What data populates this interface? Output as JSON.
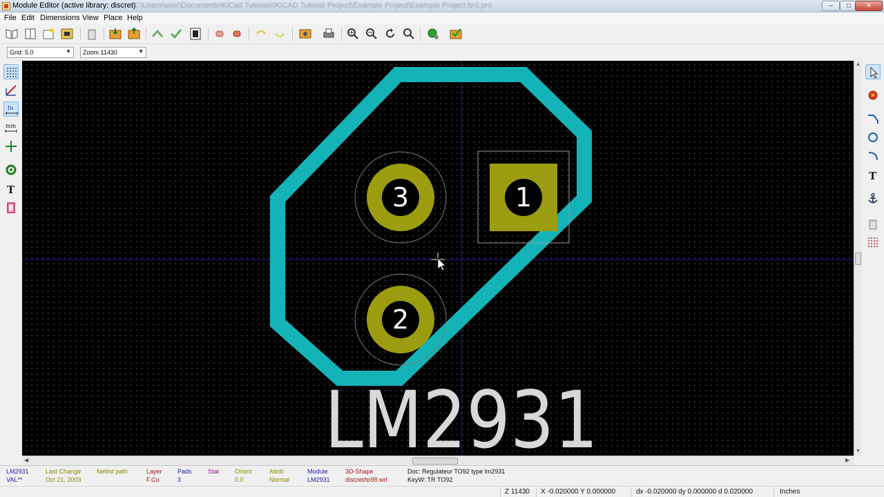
{
  "window": {
    "title": "Module Editor (active library: discret)",
    "path": "C:\\Users\\user\\Documents\\KiCad Tutorials\\KiCAD Tutorial Project\\Example Project\\Example Project.brd.pro",
    "minimize": "–",
    "maximize": "□",
    "close": "✕"
  },
  "menu": [
    "File",
    "Edit",
    "Dimensions",
    "View",
    "Place",
    "Help"
  ],
  "options": {
    "grid": "Grid: 5.0",
    "zoom": "Zoom 11430"
  },
  "colors": {
    "canvas_bg": "#000000",
    "outline": "#14b3b7",
    "pad": "#9c9c10",
    "courtyard": "#d8d8d8",
    "axis": "#1c1ca6",
    "reference_text": "#d8d8d8"
  },
  "footprint": {
    "reference": "LM2931",
    "pads": [
      {
        "number": "1",
        "shape": "rect"
      },
      {
        "number": "2",
        "shape": "circle"
      },
      {
        "number": "3",
        "shape": "circle"
      }
    ]
  },
  "left_tools": [
    {
      "icon": "grid-icon",
      "active": true
    },
    {
      "icon": "polar-coords-icon",
      "active": false
    },
    {
      "icon": "inch-units-icon",
      "label": "In",
      "active": true
    },
    {
      "icon": "mm-units-icon",
      "label": "mm",
      "active": false
    },
    {
      "icon": "cursor-shape-icon",
      "active": false
    },
    {
      "icon": "show-pads-sketch-icon",
      "active": false
    },
    {
      "icon": "text-sketch-icon",
      "label": "T",
      "active": false
    },
    {
      "icon": "edges-sketch-icon",
      "active": false
    }
  ],
  "right_tools": [
    {
      "icon": "select-arrow-icon",
      "active": true
    },
    {
      "icon": "add-pad-icon"
    },
    {
      "icon": "add-line-icon"
    },
    {
      "icon": "add-circle-icon"
    },
    {
      "icon": "add-arc-icon"
    },
    {
      "icon": "add-text-icon",
      "label": "T"
    },
    {
      "icon": "anchor-icon"
    },
    {
      "icon": "delete-icon"
    },
    {
      "icon": "pad-grid-icon"
    }
  ],
  "message_panel": {
    "columns": [
      {
        "header": "LM2931",
        "value": "VAL**",
        "color": "#1a1aa8"
      },
      {
        "header": "Last Change",
        "value": "Oct 21, 2003",
        "color": "#8a8a00"
      },
      {
        "header": "Netlist path",
        "value": "",
        "color": "#8a8a00"
      },
      {
        "header": "Layer",
        "value": "F.Cu",
        "color": "#9a1414"
      },
      {
        "header": "Pads",
        "value": "3",
        "color": "#1a1aa8"
      },
      {
        "header": "Stat",
        "value": "",
        "color": "#8a1a8a"
      },
      {
        "header": "Orient",
        "value": "0.0",
        "color": "#8a8a00"
      },
      {
        "header": "Attrib",
        "value": "Normal",
        "color": "#8a8a00"
      },
      {
        "header": "Module",
        "value": "LM2931",
        "color": "#1a1aa8"
      },
      {
        "header": "3D-Shape",
        "value": "discret/to98.wrl",
        "color": "#9a1414"
      }
    ],
    "doc": "Doc:  Regulateur TO92 type lm2931",
    "keywords": "KeyW: TR TO92"
  },
  "status": {
    "zoom": "Z 11430",
    "xy": "X -0.020000  Y 0.000000",
    "delta": "dx -0.020000  dy 0.000000  d 0.020000",
    "units": "Inches"
  }
}
